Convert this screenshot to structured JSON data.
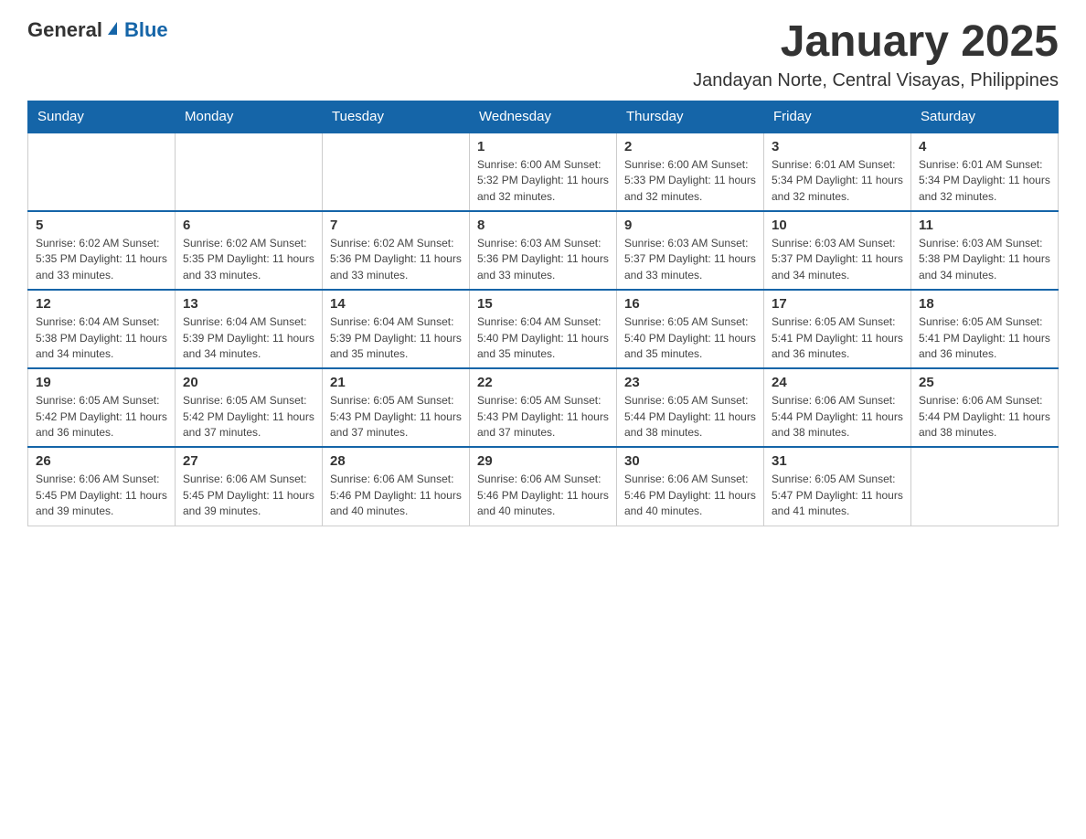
{
  "logo": {
    "general": "General",
    "blue": "Blue"
  },
  "title": "January 2025",
  "location": "Jandayan Norte, Central Visayas, Philippines",
  "days_header": [
    "Sunday",
    "Monday",
    "Tuesday",
    "Wednesday",
    "Thursday",
    "Friday",
    "Saturday"
  ],
  "weeks": [
    [
      {
        "day": "",
        "info": ""
      },
      {
        "day": "",
        "info": ""
      },
      {
        "day": "",
        "info": ""
      },
      {
        "day": "1",
        "info": "Sunrise: 6:00 AM\nSunset: 5:32 PM\nDaylight: 11 hours and 32 minutes."
      },
      {
        "day": "2",
        "info": "Sunrise: 6:00 AM\nSunset: 5:33 PM\nDaylight: 11 hours and 32 minutes."
      },
      {
        "day": "3",
        "info": "Sunrise: 6:01 AM\nSunset: 5:34 PM\nDaylight: 11 hours and 32 minutes."
      },
      {
        "day": "4",
        "info": "Sunrise: 6:01 AM\nSunset: 5:34 PM\nDaylight: 11 hours and 32 minutes."
      }
    ],
    [
      {
        "day": "5",
        "info": "Sunrise: 6:02 AM\nSunset: 5:35 PM\nDaylight: 11 hours and 33 minutes."
      },
      {
        "day": "6",
        "info": "Sunrise: 6:02 AM\nSunset: 5:35 PM\nDaylight: 11 hours and 33 minutes."
      },
      {
        "day": "7",
        "info": "Sunrise: 6:02 AM\nSunset: 5:36 PM\nDaylight: 11 hours and 33 minutes."
      },
      {
        "day": "8",
        "info": "Sunrise: 6:03 AM\nSunset: 5:36 PM\nDaylight: 11 hours and 33 minutes."
      },
      {
        "day": "9",
        "info": "Sunrise: 6:03 AM\nSunset: 5:37 PM\nDaylight: 11 hours and 33 minutes."
      },
      {
        "day": "10",
        "info": "Sunrise: 6:03 AM\nSunset: 5:37 PM\nDaylight: 11 hours and 34 minutes."
      },
      {
        "day": "11",
        "info": "Sunrise: 6:03 AM\nSunset: 5:38 PM\nDaylight: 11 hours and 34 minutes."
      }
    ],
    [
      {
        "day": "12",
        "info": "Sunrise: 6:04 AM\nSunset: 5:38 PM\nDaylight: 11 hours and 34 minutes."
      },
      {
        "day": "13",
        "info": "Sunrise: 6:04 AM\nSunset: 5:39 PM\nDaylight: 11 hours and 34 minutes."
      },
      {
        "day": "14",
        "info": "Sunrise: 6:04 AM\nSunset: 5:39 PM\nDaylight: 11 hours and 35 minutes."
      },
      {
        "day": "15",
        "info": "Sunrise: 6:04 AM\nSunset: 5:40 PM\nDaylight: 11 hours and 35 minutes."
      },
      {
        "day": "16",
        "info": "Sunrise: 6:05 AM\nSunset: 5:40 PM\nDaylight: 11 hours and 35 minutes."
      },
      {
        "day": "17",
        "info": "Sunrise: 6:05 AM\nSunset: 5:41 PM\nDaylight: 11 hours and 36 minutes."
      },
      {
        "day": "18",
        "info": "Sunrise: 6:05 AM\nSunset: 5:41 PM\nDaylight: 11 hours and 36 minutes."
      }
    ],
    [
      {
        "day": "19",
        "info": "Sunrise: 6:05 AM\nSunset: 5:42 PM\nDaylight: 11 hours and 36 minutes."
      },
      {
        "day": "20",
        "info": "Sunrise: 6:05 AM\nSunset: 5:42 PM\nDaylight: 11 hours and 37 minutes."
      },
      {
        "day": "21",
        "info": "Sunrise: 6:05 AM\nSunset: 5:43 PM\nDaylight: 11 hours and 37 minutes."
      },
      {
        "day": "22",
        "info": "Sunrise: 6:05 AM\nSunset: 5:43 PM\nDaylight: 11 hours and 37 minutes."
      },
      {
        "day": "23",
        "info": "Sunrise: 6:05 AM\nSunset: 5:44 PM\nDaylight: 11 hours and 38 minutes."
      },
      {
        "day": "24",
        "info": "Sunrise: 6:06 AM\nSunset: 5:44 PM\nDaylight: 11 hours and 38 minutes."
      },
      {
        "day": "25",
        "info": "Sunrise: 6:06 AM\nSunset: 5:44 PM\nDaylight: 11 hours and 38 minutes."
      }
    ],
    [
      {
        "day": "26",
        "info": "Sunrise: 6:06 AM\nSunset: 5:45 PM\nDaylight: 11 hours and 39 minutes."
      },
      {
        "day": "27",
        "info": "Sunrise: 6:06 AM\nSunset: 5:45 PM\nDaylight: 11 hours and 39 minutes."
      },
      {
        "day": "28",
        "info": "Sunrise: 6:06 AM\nSunset: 5:46 PM\nDaylight: 11 hours and 40 minutes."
      },
      {
        "day": "29",
        "info": "Sunrise: 6:06 AM\nSunset: 5:46 PM\nDaylight: 11 hours and 40 minutes."
      },
      {
        "day": "30",
        "info": "Sunrise: 6:06 AM\nSunset: 5:46 PM\nDaylight: 11 hours and 40 minutes."
      },
      {
        "day": "31",
        "info": "Sunrise: 6:05 AM\nSunset: 5:47 PM\nDaylight: 11 hours and 41 minutes."
      },
      {
        "day": "",
        "info": ""
      }
    ]
  ]
}
